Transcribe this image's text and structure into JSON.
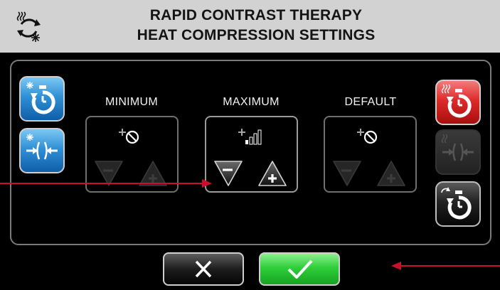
{
  "header": {
    "title_line1": "RAPID CONTRAST THERAPY",
    "title_line2": "HEAT COMPRESSION SETTINGS",
    "mode_icon": "contrast-cycle-icon"
  },
  "side_buttons": {
    "left": [
      {
        "name": "cold-timer",
        "icon": "snowflake-stopwatch-icon",
        "color": "#2f90d6"
      },
      {
        "name": "cold-compression",
        "icon": "snowflake-compression-icon",
        "color": "#2f90d6"
      }
    ],
    "right": [
      {
        "name": "heat-timer",
        "icon": "heat-stopwatch-icon",
        "color": "#de2a2a"
      },
      {
        "name": "heat-compression",
        "icon": "heat-compression-icon",
        "color": "#3a3a3a",
        "state": "selected/disabled"
      },
      {
        "name": "contrast-timer",
        "icon": "cycle-stopwatch-icon",
        "color": "#222222"
      }
    ]
  },
  "columns": [
    {
      "label": "MINIMUM",
      "level_icon": "compression-off-icon",
      "enabled": false
    },
    {
      "label": "MAXIMUM",
      "level_icon": "compression-level-1-icon",
      "level": 1,
      "level_max": 4,
      "enabled": true
    },
    {
      "label": "DEFAULT",
      "level_icon": "compression-off-icon",
      "enabled": false
    }
  ],
  "actions": {
    "cancel_icon": "x-icon",
    "confirm_icon": "check-icon",
    "cancel_color": "#1d1d1d",
    "confirm_color": "#2fcf3a"
  },
  "annotations": {
    "arrow_color": "#c8102e"
  }
}
